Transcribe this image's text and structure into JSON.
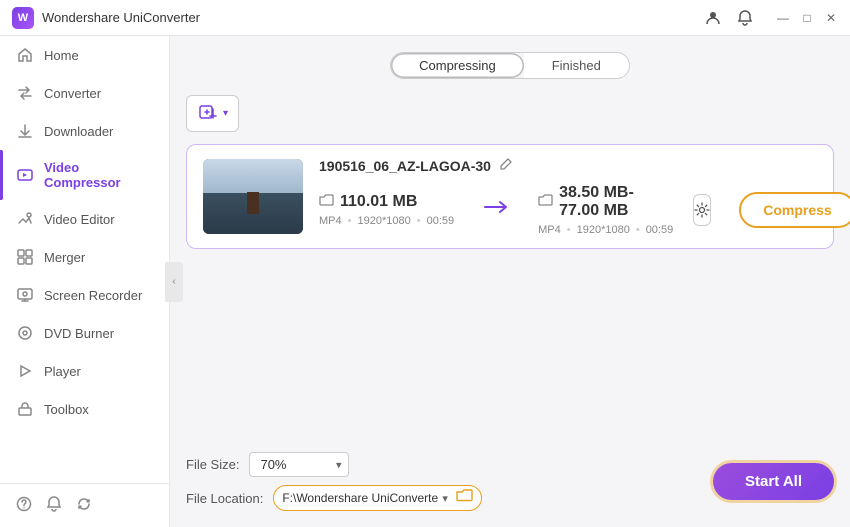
{
  "app": {
    "logo_text": "W",
    "title": "Wondershare UniConverter"
  },
  "titlebar": {
    "user_icon": "👤",
    "bell_icon": "🔔",
    "minimize_label": "—",
    "maximize_label": "□",
    "close_label": "✕"
  },
  "sidebar": {
    "items": [
      {
        "id": "home",
        "label": "Home",
        "icon": "🏠"
      },
      {
        "id": "converter",
        "label": "Converter",
        "icon": "🔄"
      },
      {
        "id": "downloader",
        "label": "Downloader",
        "icon": "⬇️"
      },
      {
        "id": "video-compressor",
        "label": "Video Compressor",
        "icon": "🎬",
        "active": true
      },
      {
        "id": "video-editor",
        "label": "Video Editor",
        "icon": "✂️"
      },
      {
        "id": "merger",
        "label": "Merger",
        "icon": "⊞"
      },
      {
        "id": "screen-recorder",
        "label": "Screen Recorder",
        "icon": "📹"
      },
      {
        "id": "dvd-burner",
        "label": "DVD Burner",
        "icon": "💿"
      },
      {
        "id": "player",
        "label": "Player",
        "icon": "▶️"
      },
      {
        "id": "toolbox",
        "label": "Toolbox",
        "icon": "🔧"
      }
    ],
    "footer": {
      "help_icon": "❓",
      "notification_icon": "🔔",
      "refresh_icon": "🔃"
    }
  },
  "tabs": {
    "compressing_label": "Compressing",
    "finished_label": "Finished",
    "active": "compressing"
  },
  "toolbar": {
    "add_label": "＋",
    "add_tooltip": "Add files"
  },
  "file_card": {
    "filename": "190516_06_AZ-LAGOA-30",
    "source": {
      "size": "110.01 MB",
      "format": "MP4",
      "resolution": "1920*1080",
      "duration": "00:59"
    },
    "dest": {
      "size": "38.50 MB-77.00 MB",
      "format": "MP4",
      "resolution": "1920*1080",
      "duration": "00:59"
    },
    "compress_label": "Compress"
  },
  "bottom": {
    "file_size_label": "File Size:",
    "file_size_value": "70%",
    "file_location_label": "File Location:",
    "file_location_value": "F:\\Wondershare UniConverte",
    "start_all_label": "Start All"
  }
}
